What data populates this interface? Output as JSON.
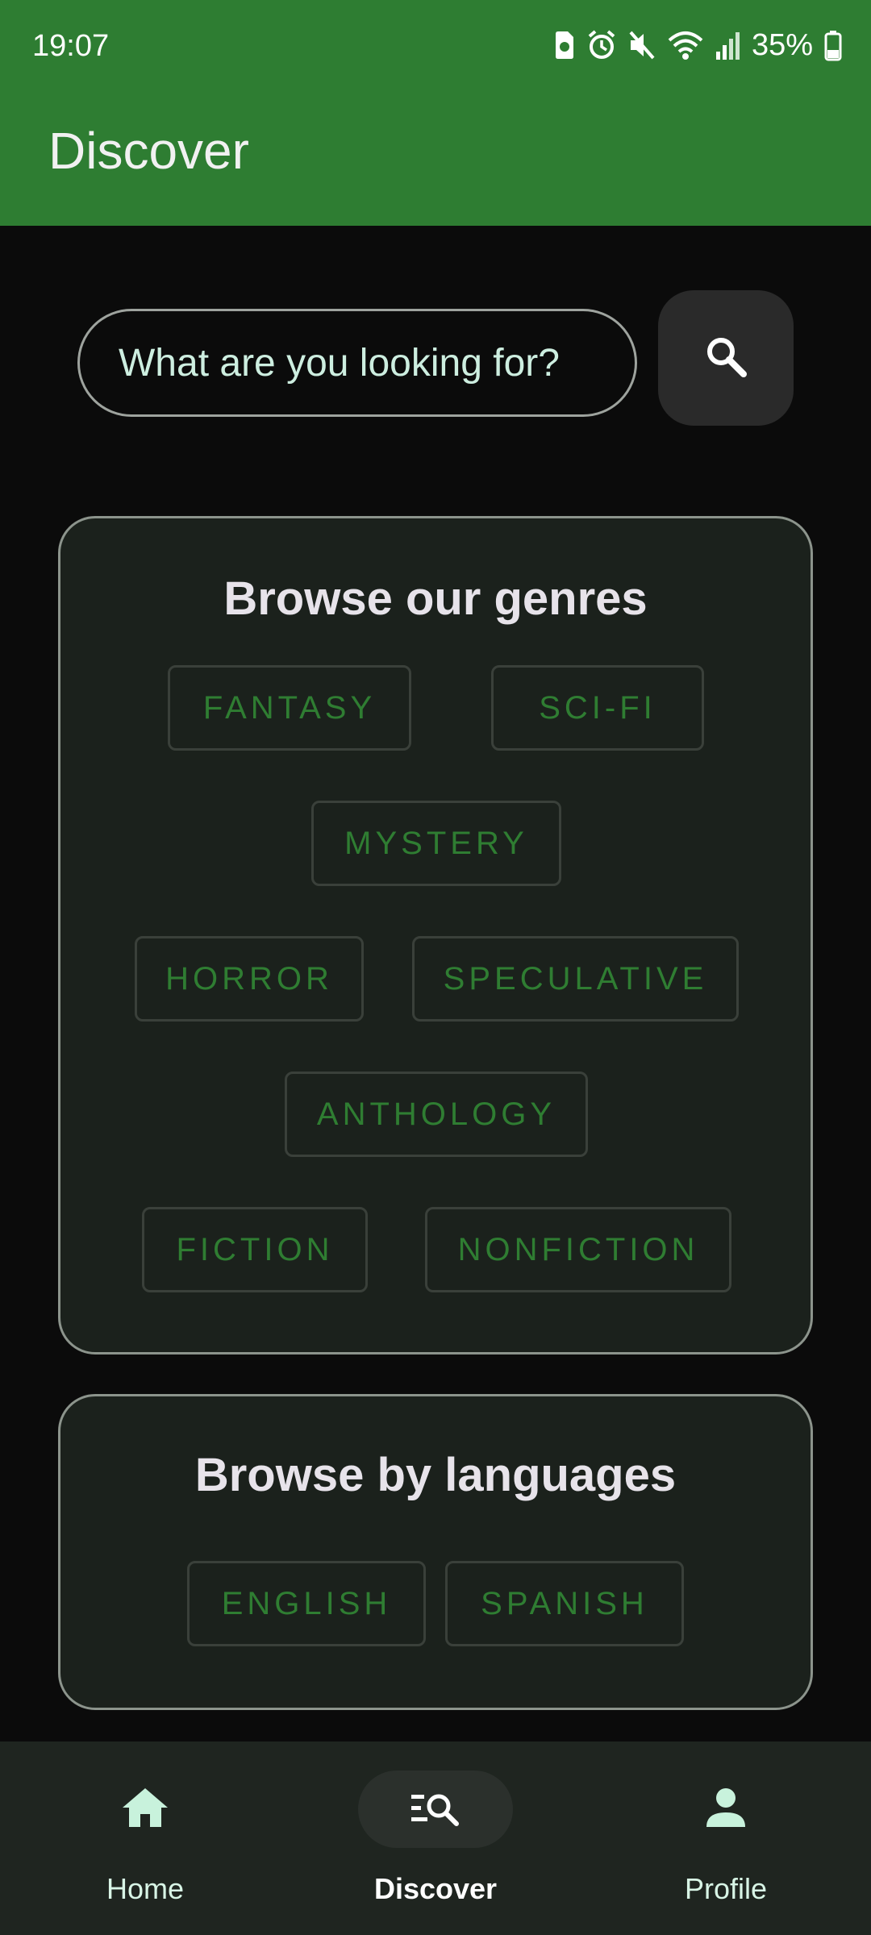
{
  "status_bar": {
    "time": "19:07",
    "battery": "35%"
  },
  "app_bar": {
    "title": "Discover"
  },
  "search": {
    "placeholder": "What are you looking for?"
  },
  "genres": {
    "title": "Browse our genres",
    "items": [
      "FANTASY",
      "SCI-FI",
      "MYSTERY",
      "HORROR",
      "SPECULATIVE",
      "ANTHOLOGY",
      "FICTION",
      "NONFICTION"
    ]
  },
  "languages": {
    "title": "Browse by languages",
    "items": [
      "ENGLISH",
      "SPANISH"
    ]
  },
  "bottom_nav": {
    "items": [
      {
        "label": "Home",
        "icon": "home-icon"
      },
      {
        "label": "Discover",
        "icon": "discover-search-icon"
      },
      {
        "label": "Profile",
        "icon": "person-icon"
      }
    ],
    "active": "Discover"
  },
  "colors": {
    "app_bar": "#2e7d32",
    "chip_text": "#2f7d32",
    "card_bg": "#1b211c",
    "nav_icon": "#c8f2dc"
  }
}
